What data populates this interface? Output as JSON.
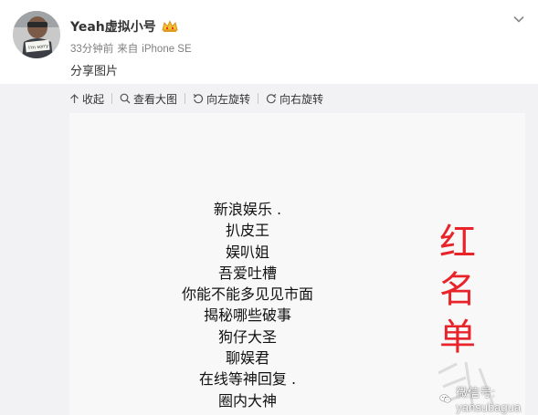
{
  "post": {
    "username": "Yeah虚拟小号",
    "time": "33分钟前",
    "source_prefix": "来自",
    "source": "iPhone SE",
    "caption": "分享图片",
    "avatar_text": "I'm sorry"
  },
  "toolbar": {
    "collapse": "收起",
    "view_large": "查看大图",
    "rotate_left": "向左旋转",
    "rotate_right": "向右旋转"
  },
  "image": {
    "lines": [
      "新浪娱乐  .",
      "扒皮王",
      "娱叭姐",
      "吾爱吐槽",
      "你能不能多见见市面",
      "揭秘哪些破事",
      "狗仔大圣",
      "聊娱君",
      "在线等神回复 .",
      "圈内大神"
    ],
    "stamp": [
      "红",
      "名",
      "单"
    ],
    "wechat_watermark": "微信号: yansubagua"
  },
  "colors": {
    "stamp_red": "#e8242a",
    "feed_bg": "#f2f2f5",
    "meta_gray": "#808080"
  }
}
